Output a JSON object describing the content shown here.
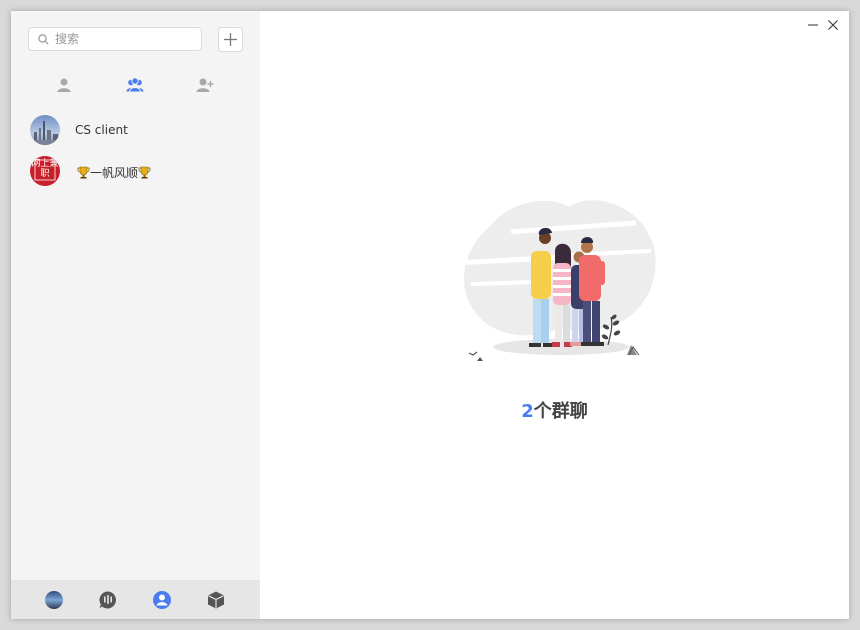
{
  "sidebar": {
    "search_placeholder": "搜索",
    "tabs": [
      {
        "name": "friends",
        "icon": "person-icon",
        "active": false
      },
      {
        "name": "groups",
        "icon": "group-icon",
        "active": true
      },
      {
        "name": "add-friend",
        "icon": "person-add-icon",
        "active": false
      }
    ],
    "contacts": [
      {
        "name": "CS client",
        "avatar": "skyline-avatar"
      },
      {
        "name": "一帆风顺",
        "avatar": "red-badge-avatar",
        "avatar_text": "网上兼职"
      }
    ],
    "bottom_icons": [
      "profile-avatar-icon",
      "chat-icon",
      "contacts-icon",
      "cube-icon"
    ]
  },
  "main": {
    "count": "2",
    "count_suffix": "个群聊"
  },
  "colors": {
    "accent": "#4a7cf0",
    "sidebar_bg": "#f4f4f4",
    "bottom_bar_bg": "#e6e6e6"
  }
}
